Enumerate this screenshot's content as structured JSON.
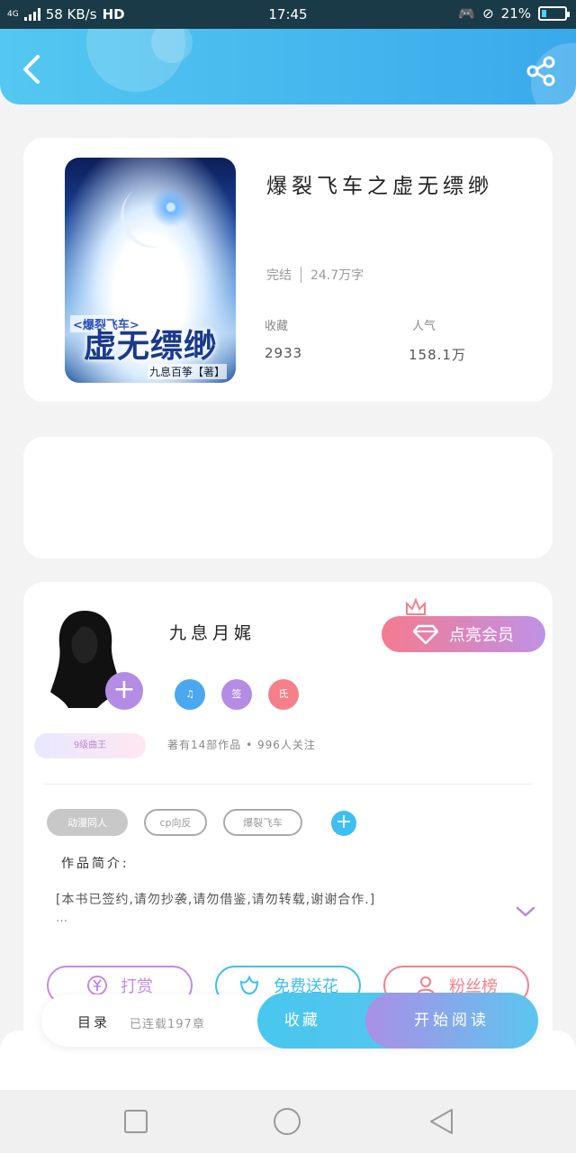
{
  "status_bar": {
    "network": "4G",
    "speed": "58 KB/s",
    "hd": "HD",
    "time": "17:45",
    "battery": "21%",
    "battery_level": 0.21
  },
  "header": {
    "back_icon": "back-arrow-icon",
    "share_icon": "share-icon"
  },
  "book": {
    "title": "爆裂飞车之虚无缥缈",
    "cover_texts": {
      "series": "<爆裂飞车>",
      "title": "虚无缥缈",
      "author_sig": "九息百筝【著】"
    },
    "status": "完结",
    "word_count": "24.7万字",
    "collect_label": "收藏",
    "collect_value": "2933",
    "popularity_label": "人气",
    "popularity_value": "158.1万"
  },
  "author": {
    "name": "九息月娓",
    "level": "9级曲王",
    "vip_button": "点亮会员",
    "badges": [
      {
        "text": "♫",
        "color": "#4aa8f0"
      },
      {
        "text": "签",
        "color": "#b58ce4"
      },
      {
        "text": "氏",
        "color": "#f4808c"
      }
    ],
    "works_line": "著有14部作品 • 996人关注"
  },
  "tags": [
    "动漫同人",
    "cp向反",
    "爆裂飞车"
  ],
  "intro": {
    "title": "作品简介:",
    "text": "[本书已签约,请勿抄袭,请勿借鉴,请勿转载,谢谢合作.]",
    "ellipsis": "…"
  },
  "actions": [
    {
      "label": "打赏",
      "icon": "yen-icon",
      "color": "#c08be6"
    },
    {
      "label": "免费送花",
      "icon": "flower-icon",
      "color": "#3dbff0"
    },
    {
      "label": "粉丝榜",
      "icon": "user-icon",
      "color": "#f4808c"
    }
  ],
  "bottom_bar": {
    "catalog": "目录",
    "update": "已连载197章",
    "collect": "收藏",
    "read": "开始阅读"
  }
}
